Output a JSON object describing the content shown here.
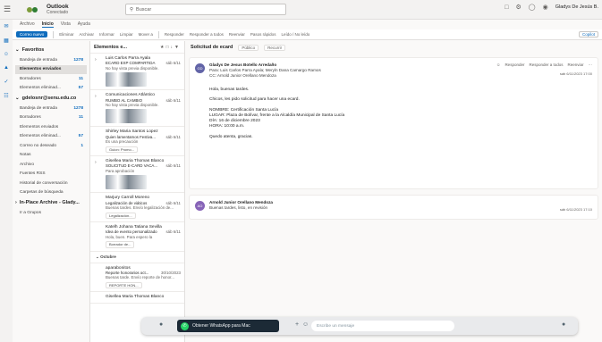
{
  "app": {
    "title": "Outlook",
    "subtitle": "Conectado",
    "search_placeholder": "Buscar",
    "user": "Gladys De Jesús B."
  },
  "menu": [
    "Archivo",
    "Inicio",
    "Vista",
    "Ayuda"
  ],
  "menu_active": "Inicio",
  "ribbon": {
    "new_mail": "Correo nuevo",
    "items": [
      "Eliminar",
      "Archivar",
      "Informar",
      "Limpiar",
      "Mover a",
      "Responder",
      "Responder a todos",
      "Reenviar",
      "Pasos rápidos",
      "Leído / No leído"
    ],
    "copilot": "Copilot"
  },
  "folders": {
    "favorites_label": "Favoritos",
    "favorites": [
      {
        "label": "Bandeja de entrada",
        "count": "1278"
      },
      {
        "label": "Elementos enviados",
        "count": ""
      },
      {
        "label": "Borradores",
        "count": "11"
      },
      {
        "label": "Elementos eliminad...",
        "count": "57"
      }
    ],
    "account": "gdelosnr@senu.edu.co",
    "account_folders": [
      {
        "label": "Bandeja de entrada",
        "count": "1278"
      },
      {
        "label": "Borradores",
        "count": "11"
      },
      {
        "label": "Elementos enviados",
        "count": ""
      },
      {
        "label": "Elementos eliminad...",
        "count": "57"
      },
      {
        "label": "Correo no deseado",
        "count": "1"
      },
      {
        "label": "Notas",
        "count": ""
      },
      {
        "label": "Archivo",
        "count": ""
      },
      {
        "label": "Fuentes RSS",
        "count": ""
      },
      {
        "label": "Historial de conversación",
        "count": ""
      },
      {
        "label": "Carpetas de búsqueda",
        "count": ""
      }
    ],
    "archive_label": "In-Place Archive - Glady...",
    "groups_label": "Ir a Grupos"
  },
  "list": {
    "header": "Elementos e...",
    "messages": [
      {
        "from": "Luis Carlos Parra Ayala",
        "subject": "ECARD EXP COMPARTIDA",
        "date": "sáb 6/11",
        "preview": "No hay vista previa disponible.",
        "thumb": true
      },
      {
        "from": "Comunicaciones Atlántico",
        "subject": "RUMBO AL CAMBIO",
        "date": "sáb 6/11",
        "preview": "No hay vista previa disponible.",
        "thumb": true
      },
      {
        "from": "Shirley Maria Santos Lopez",
        "subject": "Quien lamentamos Festiva...",
        "date": "sáb 6/11",
        "preview": "Es una precaución",
        "attach": "Guion: Promo..."
      },
      {
        "from": "Gisellea Maria Thomas Blanco",
        "subject": "SOLICITUD E-CARD VACA...",
        "date": "sáb 6/11",
        "preview": "Para aprobación",
        "thumb": true
      },
      {
        "from": "Marjury Carroll Moreno",
        "subject": "Legalización de viáticos",
        "date": "sáb 6/11",
        "preview": "Buenas tardes. Envío legalización de...",
        "attach": "Legalización..."
      },
      {
        "from": "Katelh Johana Tatiana Sevilla",
        "subject": "Idea de evento personalizado",
        "date": "sáb 6/11",
        "preview": "Hola, buen. Para espero la",
        "attach": "Borrador de..."
      }
    ],
    "group_label": "Octubre",
    "older": [
      {
        "from": "aparabonitos",
        "subject": "Reporte honorarios oct...",
        "date": "30/10/2023",
        "preview": "Buenas tarde. Envío reporte de honor...",
        "attach": "REPORTE HON..."
      },
      {
        "from": "Gisellea Maria Thomas Blanco",
        "subject": "",
        "date": "",
        "preview": ""
      }
    ]
  },
  "reading": {
    "subject": "Solicitud de ecard",
    "tags": [
      "Público",
      "Recurrir"
    ],
    "messages": [
      {
        "initials": "GD",
        "sender": "Gladys De Jesus Botello Arredaño",
        "to": "Para: Luis Carlos Parra Ayala; Meryln Dana Camargo Ramos",
        "cc": "CC: Arnold Junior Orellano Mendoza",
        "date": "sáb 6/11/2023 17:00",
        "actions": [
          "Responder",
          "Responder a todos",
          "Reenviar"
        ],
        "body": [
          "Hola, buenas tardes.",
          "Chicos, les pido solicitud para hacer una ecard.",
          "NOMBRE: Certificación Santa Lucía",
          "LUGAR: Plaza de Bolívar, frente a la Alcaldía Municipal de Santa Lucía",
          "DÍA: 16 de diciembre 2023",
          "HORA: 10:00 a.m.",
          "Quedo atenta, gracias."
        ]
      },
      {
        "initials": "AO",
        "sender": "Arnold Junior Orellano Mendoza",
        "preview": "Buenas tardes, listo, en revisión",
        "date": "sáb 6/11/2023 17:10"
      }
    ]
  },
  "taskbar": {
    "banner": "Obtener WhatsApp para Mac",
    "input_placeholder": "Escribe un mensaje"
  },
  "colors": {
    "accent": "#0f6cbd",
    "whatsapp": "#25d366"
  }
}
